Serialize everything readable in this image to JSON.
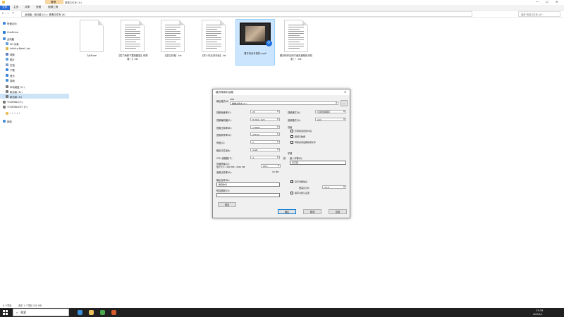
{
  "titlebar": {
    "context_tab": "管理",
    "path_title": "看看文件夹 (X:)"
  },
  "ribbon": {
    "tabs": [
      "文件",
      "主页",
      "共享",
      "查看",
      "视频工具"
    ]
  },
  "address": {
    "crumbs": "此电脑 › 新加卷 (X:) › 看看文件夹 (X)",
    "search_placeholder": "搜索\"看看文件夹 (X)\""
  },
  "nav": {
    "items": [
      {
        "label": "快速访问",
        "icon": "star-icon",
        "color": "#3d86e0"
      },
      {
        "label": "OneDrive",
        "icon": "cloud-icon",
        "color": "#2b7cd3"
      },
      {
        "label": "此电脑",
        "icon": "computer-icon",
        "color": "#4a90d9"
      },
      {
        "label": "3D 对象",
        "icon": "cube-icon",
        "color": "#5aa0e0"
      },
      {
        "label": "Infinity-Beta1.zip",
        "icon": "zip-icon",
        "color": "#e0b84a"
      },
      {
        "label": "视频",
        "icon": "video-icon",
        "color": "#5a7fc0"
      },
      {
        "label": "图片",
        "icon": "picture-icon",
        "color": "#5aa0e0"
      },
      {
        "label": "文档",
        "icon": "document-icon",
        "color": "#7a9cc9"
      },
      {
        "label": "下载",
        "icon": "download-icon",
        "color": "#3d86e0"
      },
      {
        "label": "音乐",
        "icon": "music-icon",
        "color": "#3d86e0"
      },
      {
        "label": "桌面",
        "icon": "desktop-icon",
        "color": "#4a90d9"
      },
      {
        "label": "本地磁盘 (C:)",
        "icon": "drive-icon",
        "color": "#777777"
      },
      {
        "label": "新加卷 (D:)",
        "icon": "drive-icon",
        "color": "#777777"
      },
      {
        "label": "新加卷 (X:)",
        "icon": "drive-icon",
        "color": "#777777"
      },
      {
        "label": "TOSHIBA (E:)",
        "icon": "usb-drive-icon",
        "color": "#777777"
      },
      {
        "label": "TOSHIBA EXT (F:)",
        "icon": "usb-drive-icon",
        "color": "#777777"
      },
      {
        "label": "• • • • •",
        "icon": "folder-icon",
        "color": "#e8c15a"
      },
      {
        "label": "网络",
        "icon": "network-icon",
        "color": "#4a90d9"
      }
    ]
  },
  "files": [
    {
      "name": "2大Store",
      "type": "doc"
    },
    {
      "name": "【发了两家下载到超能】传闻卷！】.txt",
      "type": "txt"
    },
    {
      "name": "【定位手续】.txt",
      "type": "txt"
    },
    {
      "name": "【失人失业务手续】.txt",
      "type": "txt"
    },
    {
      "name": "看手机对手的机.mp4",
      "type": "video"
    },
    {
      "name": "看到你好见研平面热度相机动机机！！.txt",
      "type": "txt"
    }
  ],
  "status": {
    "count": "6 个项目",
    "selected": "选中 1 个项目 100 MB"
  },
  "taskbar": {
    "search": "搜索",
    "time": "13:34",
    "date": "2023/1/1"
  },
  "dialog": {
    "title": "格式转换对话框",
    "src_label": "输出格式(A)",
    "src_value": "MP4",
    "path_label": "输出路径(P):",
    "path_value": "看看文件夹 (X:)",
    "left_fields": [
      {
        "label": "视频帧速率(F):",
        "value": "25"
      },
      {
        "label": "视频编码器(E):",
        "value": "H.264 / AVC"
      },
      {
        "label": "视频比特率(B):",
        "value": "1 Mbps"
      },
      {
        "label": "音频采样率(S):",
        "value": "44100"
      },
      {
        "label": "声道(C):",
        "value": "2"
      },
      {
        "label": "输出文件最大:",
        "value": "4 GB"
      },
      {
        "label": "CPU 线程数(T):",
        "value": "4"
      }
    ],
    "cpu_unit": "核",
    "quality_label": "压缩质量(Q):",
    "quality_sub": "估计大小: 1000 MB / 4000 MB",
    "quality_value": "60%",
    "audio_label": "音频比特率(A):",
    "audio_value": "16 MB",
    "output_title": "输出名称(N):",
    "output_value": "看到你好",
    "output_title2": "附加参数(O):",
    "preview_button": "预览",
    "right_fields": [
      {
        "label": "视频格式(V):",
        "value": "与原视频相同"
      },
      {
        "label": "音频格式(U):",
        "value": "AAC"
      }
    ],
    "advanced_title": "高级",
    "checks": [
      {
        "label": "仅转换选定的片段",
        "checked": false
      },
      {
        "label": "保留元数据",
        "checked": false
      },
      {
        "label": "转换完成后删除源文件",
        "checked": false
      }
    ],
    "subtitle_title": "字幕",
    "subtitle_label": "嵌入字幕(S):",
    "subtitle_value": "无字幕",
    "bottom_checks": [
      {
        "label": "显示详细信息",
        "checked": true
      },
      {
        "label": "保存为默认设置",
        "checked": false
      }
    ],
    "ratio_label": "宽高比(R):",
    "ratio_value": "16:9",
    "buttons": {
      "ok": "确定",
      "cancel": "取消",
      "apply": "应用"
    }
  }
}
